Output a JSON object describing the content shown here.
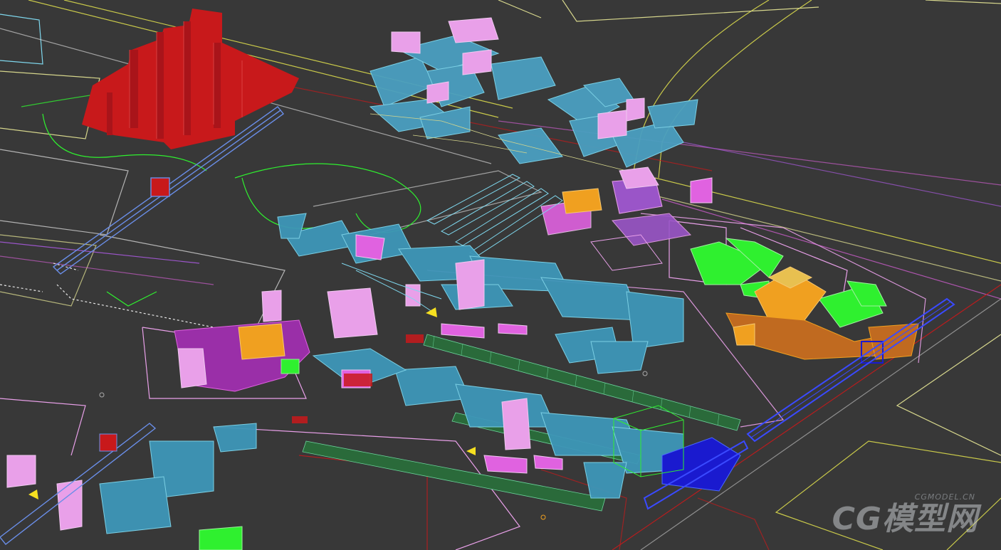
{
  "viewport": {
    "background": "#383838",
    "line_colors": {
      "yellow": "#c9c94a",
      "pale_yellow": "#d6d68c",
      "magenta": "#e062e0",
      "pink": "#e9a0e9",
      "cyan": "#49b6d8",
      "light_cyan": "#7fd8ee",
      "green": "#2ff02f",
      "red": "#c8191b",
      "blue": "#1a1acf",
      "orange": "#f0a020",
      "white": "#e8e8e8",
      "purple": "#9a55c8"
    }
  },
  "watermark": {
    "brand": "CG模型网",
    "domain": "CGMODEL.CN"
  }
}
